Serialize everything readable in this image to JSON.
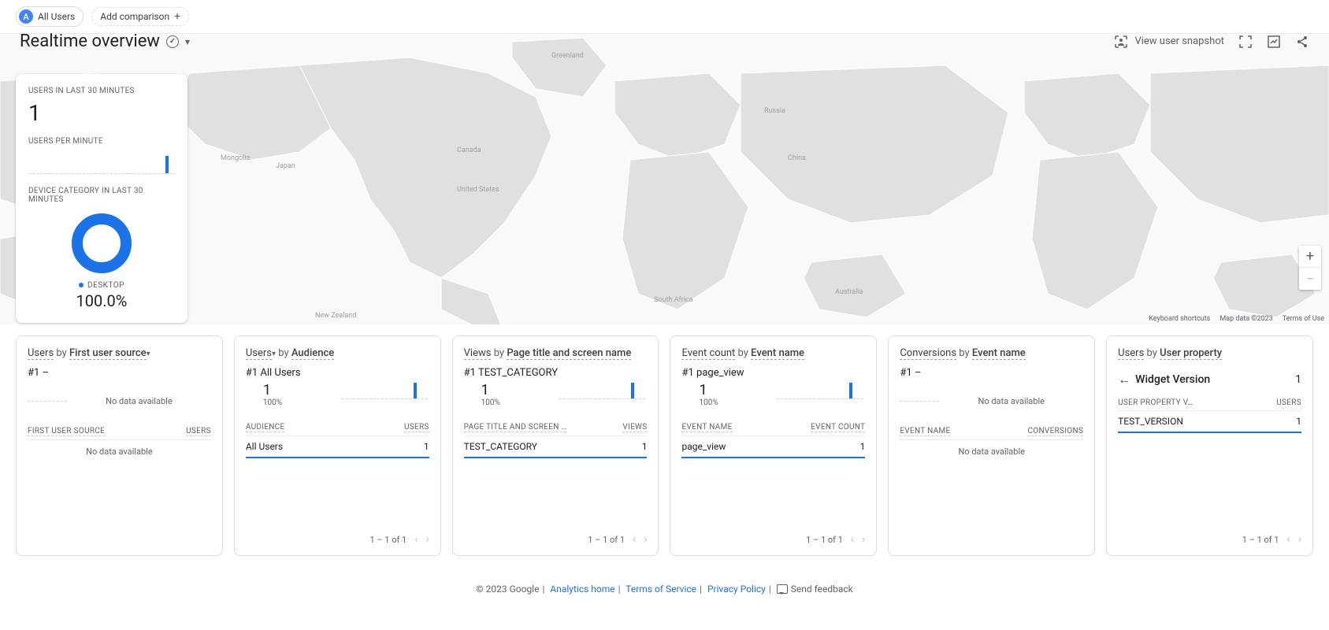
{
  "segment": {
    "badge": "A",
    "name": "All Users"
  },
  "add_comparison": "Add comparison",
  "page_title": "Realtime overview",
  "snapshot_label": "View user snapshot",
  "overview": {
    "users_label": "USERS IN LAST 30 MINUTES",
    "users_value": "1",
    "upm_label": "USERS PER MINUTE",
    "device_label": "DEVICE CATEGORY IN LAST 30 MINUTES",
    "device_name": "DESKTOP",
    "device_pct": "100.0%"
  },
  "map_attr": {
    "shortcuts": "Keyboard shortcuts",
    "data": "Map data ©2023",
    "terms": "Terms of Use"
  },
  "cards": {
    "c1": {
      "title_a": "Users",
      "title_by": "by",
      "title_b": "First user source",
      "rank": "#1  –",
      "no_data_spark": "No data available",
      "col1": "FIRST USER SOURCE",
      "col2": "USERS",
      "no_data": "No data available"
    },
    "c2": {
      "title_a": "Users",
      "title_by": "by",
      "title_b": "Audience",
      "rank": "#1  All Users",
      "val": "1",
      "sub": "100%",
      "col1": "AUDIENCE",
      "col2": "USERS",
      "row_name": "All Users",
      "row_val": "1",
      "pager": "1 – 1 of 1"
    },
    "c3": {
      "title_a": "Views",
      "title_by": "by",
      "title_b": "Page title and screen name",
      "rank": "#1  TEST_CATEGORY",
      "val": "1",
      "sub": "100%",
      "col1": "PAGE TITLE AND SCREEN …",
      "col2": "VIEWS",
      "row_name": "TEST_CATEGORY",
      "row_val": "1",
      "pager": "1 – 1 of 1"
    },
    "c4": {
      "title_a": "Event count",
      "title_by": "by",
      "title_b": "Event name",
      "rank": "#1  page_view",
      "val": "1",
      "sub": "100%",
      "col1": "EVENT NAME",
      "col2": "EVENT COUNT",
      "row_name": "page_view",
      "row_val": "1",
      "pager": "1 – 1 of 1"
    },
    "c5": {
      "title_a": "Conversions",
      "title_by": "by",
      "title_b": "Event name",
      "rank": "#1  –",
      "no_data_spark": "No data available",
      "col1": "EVENT NAME",
      "col2": "CONVERSIONS",
      "no_data": "No data available"
    },
    "c6": {
      "title_a": "Users",
      "title_by": "by",
      "title_b": "User property",
      "prop_name": "Widget Version",
      "prop_count": "1",
      "col1": "USER PROPERTY V…",
      "col2": "USERS",
      "row_name": "TEST_VERSION",
      "row_val": "1",
      "pager": "1 – 1 of 1"
    }
  },
  "footer": {
    "copyright": "© 2023 Google",
    "links": {
      "home": "Analytics home",
      "tos": "Terms of Service",
      "privacy": "Privacy Policy"
    },
    "feedback": "Send feedback"
  }
}
